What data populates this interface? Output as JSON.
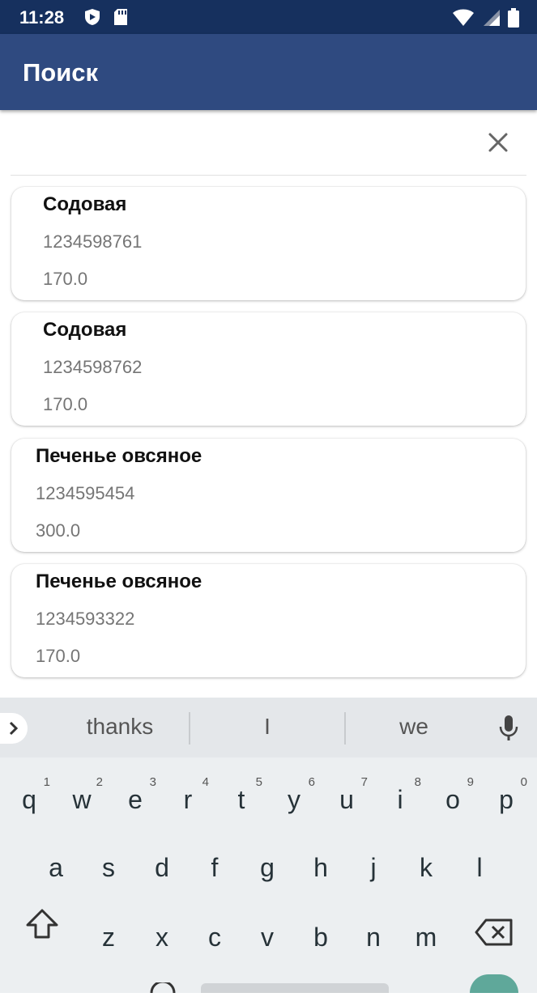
{
  "status_bar": {
    "time": "11:28"
  },
  "app_bar": {
    "title": "Поиск"
  },
  "search": {
    "value": "",
    "placeholder": ""
  },
  "results": [
    {
      "name": "Содовая",
      "code": "1234598761",
      "price": "170.0"
    },
    {
      "name": "Содовая",
      "code": "1234598762",
      "price": "170.0"
    },
    {
      "name": "Печенье овсяное",
      "code": "1234595454",
      "price": "300.0"
    },
    {
      "name": "Печенье овсяное",
      "code": "1234593322",
      "price": "170.0"
    }
  ],
  "keyboard": {
    "suggestions": [
      "thanks",
      "I",
      "we"
    ],
    "row1": [
      {
        "letter": "q",
        "hint": "1"
      },
      {
        "letter": "w",
        "hint": "2"
      },
      {
        "letter": "e",
        "hint": "3"
      },
      {
        "letter": "r",
        "hint": "4"
      },
      {
        "letter": "t",
        "hint": "5"
      },
      {
        "letter": "y",
        "hint": "6"
      },
      {
        "letter": "u",
        "hint": "7"
      },
      {
        "letter": "i",
        "hint": "8"
      },
      {
        "letter": "o",
        "hint": "9"
      },
      {
        "letter": "p",
        "hint": "0"
      }
    ],
    "row2": [
      "a",
      "s",
      "d",
      "f",
      "g",
      "h",
      "j",
      "k",
      "l"
    ],
    "row3": [
      "z",
      "x",
      "c",
      "v",
      "b",
      "n",
      "m"
    ]
  }
}
